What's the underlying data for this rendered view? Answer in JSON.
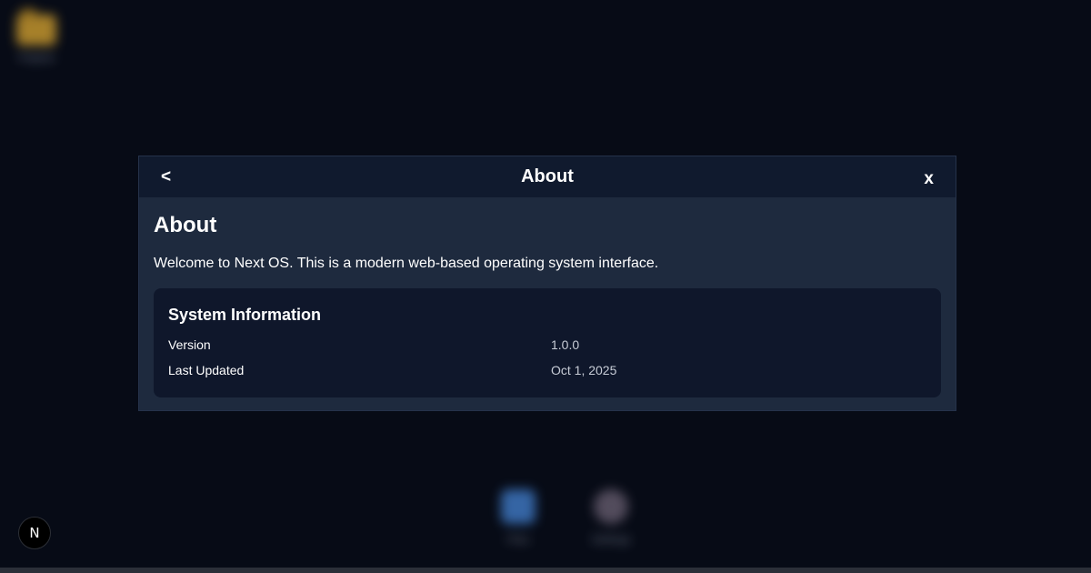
{
  "desktop": {
    "folder_icon": "folder-icon",
    "folder_label": "Projects",
    "dock": [
      {
        "label": "Files",
        "icon": "app-tile-icon"
      },
      {
        "label": "Settings",
        "icon": "settings-icon"
      }
    ],
    "badge_letter": "N"
  },
  "window": {
    "back_label": "<",
    "title": "About",
    "close_label": "x",
    "heading": "About",
    "description": "Welcome to Next OS. This is a modern web-based operating system interface.",
    "card_title": "System Information",
    "rows": [
      {
        "label": "Version",
        "value": "1.0.0"
      },
      {
        "label": "Last Updated",
        "value": "Oct 1, 2025"
      }
    ]
  },
  "colors": {
    "desktop_bg": "#070b16",
    "titlebar_bg": "#101a2e",
    "window_bg": "#1e2a3e",
    "card_bg": "#0f172b"
  }
}
